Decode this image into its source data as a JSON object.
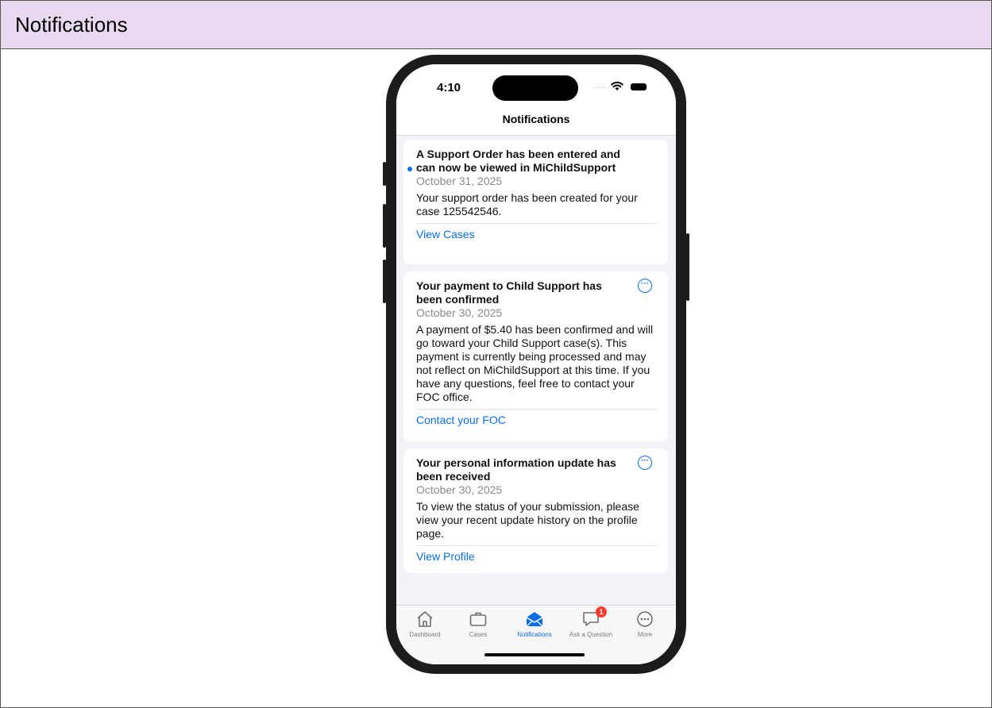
{
  "frame": {
    "title": "Notifications"
  },
  "status_bar": {
    "time": "4:10",
    "signal_dots": "....",
    "icons": [
      "wifi-icon",
      "battery-icon"
    ]
  },
  "nav": {
    "title": "Notifications"
  },
  "notifications": [
    {
      "title": "A Support Order has been entered and can now be viewed in MiChildSupport",
      "date": "October 31, 2025",
      "body": "Your support order has been created for your case 125542546.",
      "action": "View Cases",
      "unread": true
    },
    {
      "title": "Your payment to Child Support has been confirmed",
      "date": "October 30, 2025",
      "body": "A payment of $5.40 has been confirmed and will go toward your Child Support case(s). This payment is currently being processed and may not reflect on MiChildSupport at this time. If you have any questions, feel free to contact your FOC office.",
      "action": "Contact your FOC",
      "more_icon": "ellipsis-circle-icon"
    },
    {
      "title": "Your personal information update has been received",
      "date": "October 30, 2025",
      "body": "To view the status of your submission, please view your recent update history on the profile page.",
      "action": "View Profile",
      "more_icon": "ellipsis-circle-icon"
    }
  ],
  "tab_bar": {
    "tabs": [
      {
        "label": "Dashboard",
        "icon": "house-icon"
      },
      {
        "label": "Cases",
        "icon": "briefcase-icon"
      },
      {
        "label": "Notifications",
        "icon": "envelope-icon",
        "active": true
      },
      {
        "label": "Ask a Question",
        "icon": "chat-bubble-icon",
        "badge": "1"
      },
      {
        "label": "More",
        "icon": "ellipsis-circle-icon"
      }
    ]
  },
  "colors": {
    "accent": "#0a6fe6",
    "badge": "#ff3b30",
    "header_bg": "#e8d9f0"
  }
}
